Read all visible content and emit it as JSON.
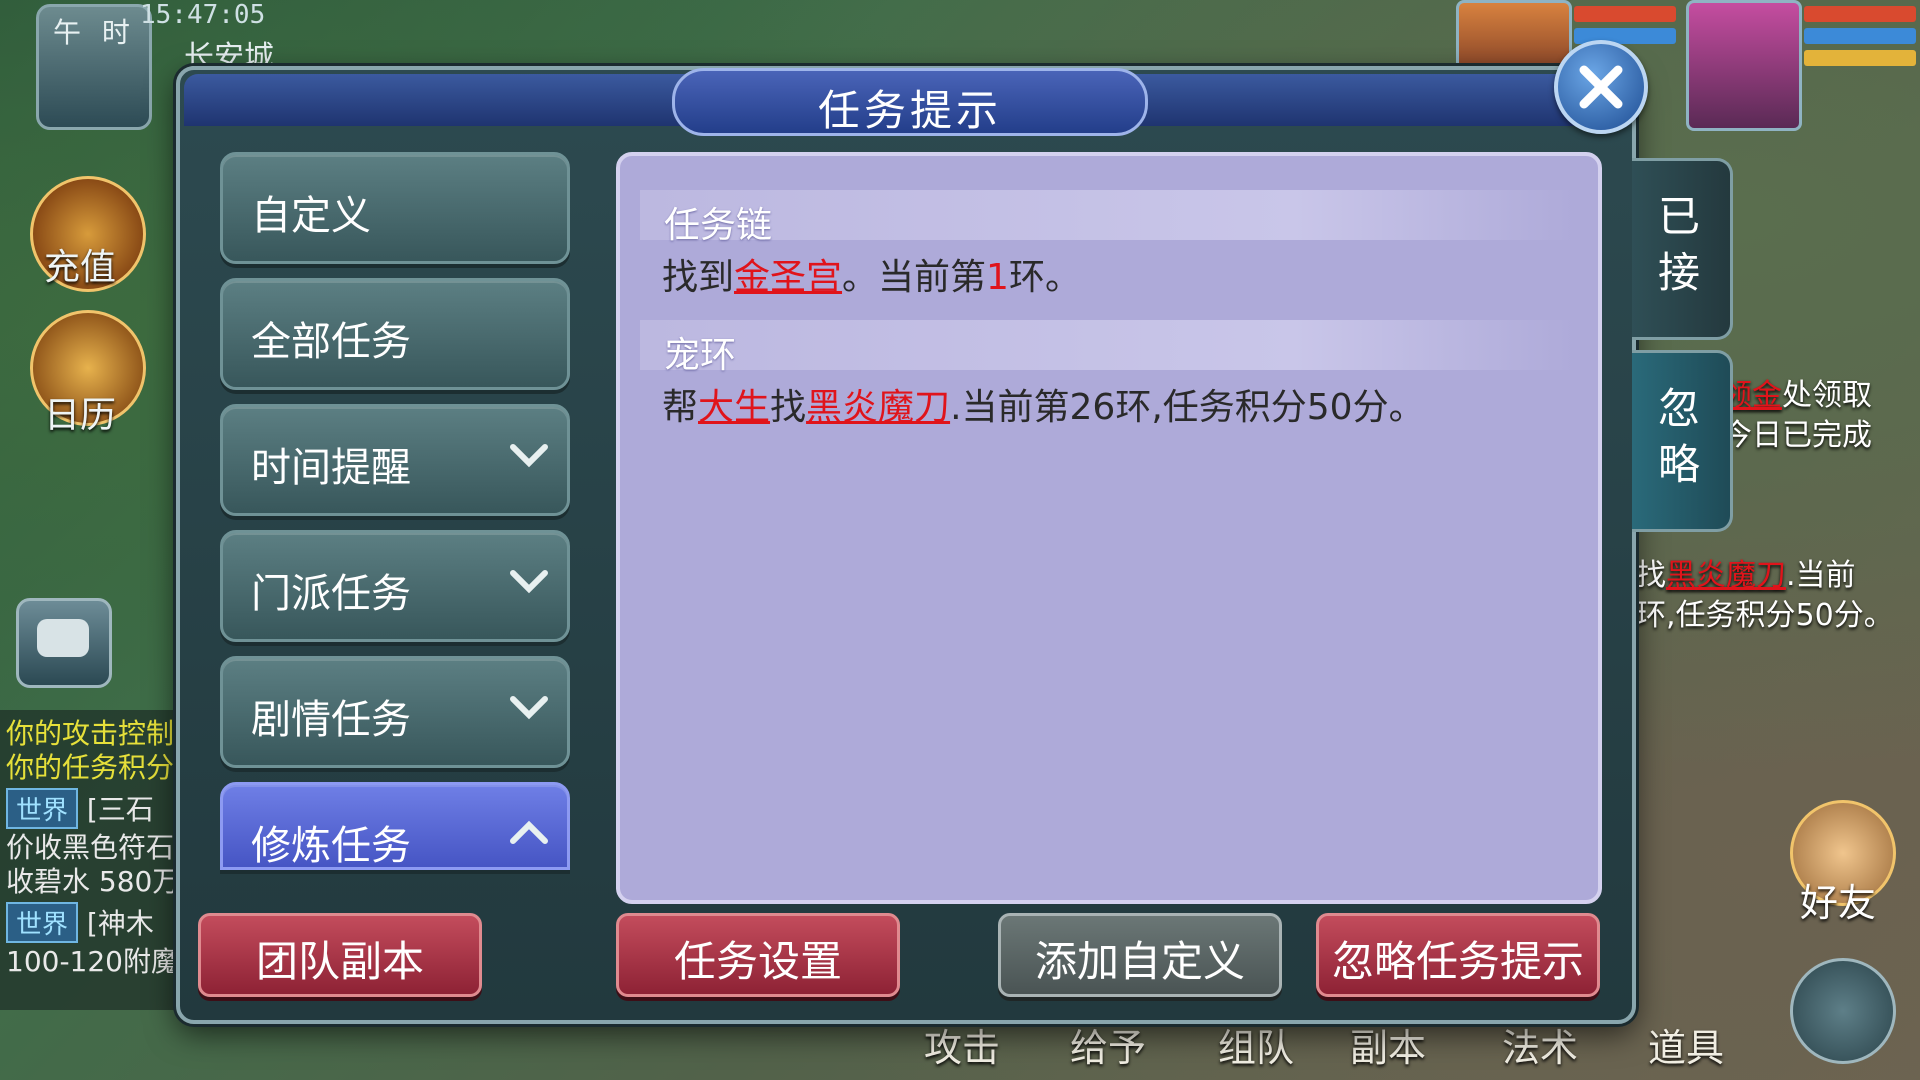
{
  "hud": {
    "time_of_day": "午 时",
    "clock": "15:47:05",
    "location": "长安城",
    "recharge_label": "充值",
    "calendar_label": "日历"
  },
  "chat": {
    "lines": [
      {
        "text": "你的攻击控制",
        "color": "#e6e03a"
      },
      {
        "text": "你的任务积分",
        "color": "#e6e03a"
      }
    ],
    "world_badge": "世界",
    "world_msgs": [
      {
        "prefix": "[三石",
        "body1": "价收黑色符石",
        "body2": "收碧水 580万"
      },
      {
        "prefix": "[神木",
        "body1": "100-120附魔"
      }
    ]
  },
  "modal": {
    "title": "任务提示",
    "categories": [
      {
        "label": "自定义",
        "expandable": false,
        "active": false
      },
      {
        "label": "全部任务",
        "expandable": false,
        "active": false
      },
      {
        "label": "时间提醒",
        "expandable": true,
        "active": false
      },
      {
        "label": "门派任务",
        "expandable": true,
        "active": false
      },
      {
        "label": "剧情任务",
        "expandable": true,
        "active": false
      },
      {
        "label": "修炼任务",
        "expandable": true,
        "active": true
      }
    ],
    "sections": [
      {
        "heading": "任务链",
        "t1": "找到",
        "t2": "金圣宫",
        "t3": "。当前第",
        "t4": "1",
        "t5": "环。"
      },
      {
        "heading": "宠环",
        "t1": "帮",
        "t2": "大生",
        "t3": "找",
        "t4": "黑炎魔刀",
        "t5": ".当前第26环,任务积分50分。"
      }
    ],
    "side_tabs": {
      "accepted": "已接",
      "ignored": "忽略"
    },
    "buttons": {
      "team_dungeon": "团队副本",
      "task_settings": "任务设置",
      "add_custom": "添加自定义",
      "ignore_hint": "忽略任务提示"
    }
  },
  "right_panel": {
    "line1a": "领金",
    "line1b": "处领取",
    "line2": "今日已完成",
    "line3a": "找",
    "line3b": "黑炎魔刀",
    "line3c": ".当前",
    "line4": "环,任务积分50分。",
    "friend_label": "好友"
  },
  "bottom_bar": [
    "攻击",
    "给予",
    "组队",
    "副本",
    "法术",
    "道具"
  ],
  "colors": {
    "accent_red": "#e0141b",
    "content_bg": "#aeaad9",
    "active_tab": "#5a68d6",
    "danger_button": "#a83246"
  }
}
